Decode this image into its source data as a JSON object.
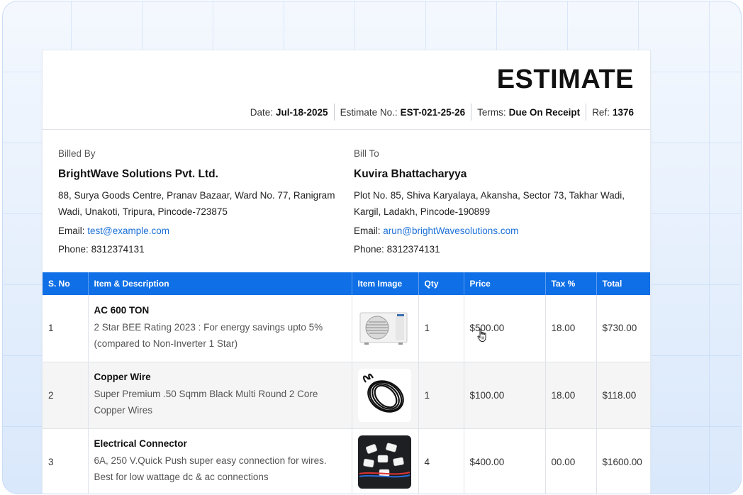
{
  "document": {
    "title": "ESTIMATE",
    "meta": [
      {
        "label": "Date:",
        "value": "Jul-18-2025"
      },
      {
        "label": "Estimate No.:",
        "value": "EST-021-25-26"
      },
      {
        "label": "Terms:",
        "value": "Due On Receipt"
      },
      {
        "label": "Ref:",
        "value": "1376"
      }
    ]
  },
  "billed_by": {
    "label": "Billed By",
    "name": "BrightWave Solutions Pvt. Ltd.",
    "address": "88, Surya Goods Centre, Pranav Bazaar, Ward No. 77, Ranigram Wadi, Unakoti, Tripura, Pincode-723875",
    "email_label": "Email:",
    "email": "test@example.com",
    "phone_label": "Phone:",
    "phone": "8312374131"
  },
  "bill_to": {
    "label": "Bill To",
    "name": "Kuvira Bhattacharyya",
    "address": "Plot No. 85, Shiva Karyalaya, Akansha, Sector 73, Takhar Wadi, Kargil, Ladakh, Pincode-190899",
    "email_label": "Email:",
    "email": "arun@brightWavesolutions.com",
    "phone_label": "Phone:",
    "phone": "8312374131"
  },
  "table": {
    "headers": [
      "S. No",
      "Item & Description",
      "Item Image",
      "Qty",
      "Price",
      "Tax %",
      "Total"
    ],
    "rows": [
      {
        "sno": "1",
        "name": "AC 600 TON",
        "desc": "2 Star BEE Rating 2023 : For energy savings upto 5% (compared to Non-Inverter 1 Star)",
        "image": "air-conditioner-image",
        "qty": "1",
        "price": "$500.00",
        "tax": "18.00",
        "total": "$730.00"
      },
      {
        "sno": "2",
        "name": "Copper Wire",
        "desc": "Super Premium .50 Sqmm Black Multi Round 2 Core Copper Wires",
        "image": "black-wire-coil-image",
        "qty": "1",
        "price": "$100.00",
        "tax": "18.00",
        "total": "$118.00"
      },
      {
        "sno": "3",
        "name": "Electrical Connector",
        "desc": "6A, 250 V.Quick Push super easy connection for wires. Best for low wattage dc & ac connections",
        "image": "push-connectors-image",
        "qty": "4",
        "price": "$400.00",
        "tax": "00.00",
        "total": "$1600.00"
      }
    ]
  },
  "colors": {
    "accent": "#0f6fe6",
    "link": "#1a6fd6"
  }
}
